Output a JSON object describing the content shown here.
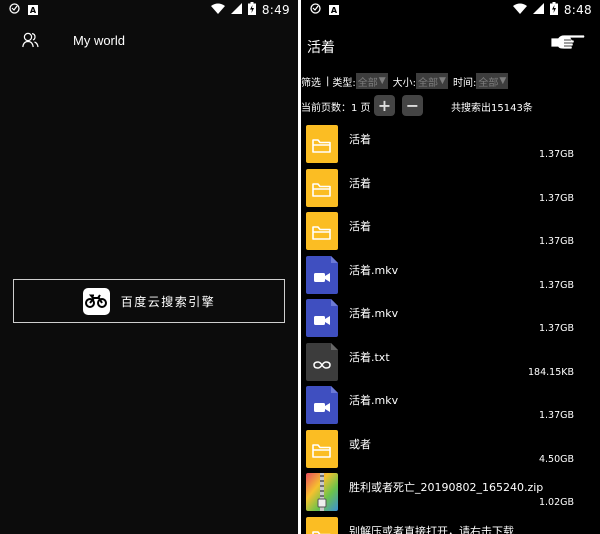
{
  "left": {
    "status": {
      "time": "8:49"
    },
    "header": {
      "title": "My world"
    },
    "search_engine": {
      "label": "百度云搜索引擎"
    }
  },
  "right": {
    "status": {
      "time": "8:48"
    },
    "toolbar": {
      "title": "活着"
    },
    "filters": {
      "screen_label": "筛选",
      "separator": "|",
      "type_label": "类型:",
      "type_value": "全部",
      "size_label": "大小:",
      "size_value": "全部",
      "time_label": "时间:",
      "time_value": "全部"
    },
    "paging": {
      "current_page_label": "当前页数：1 页",
      "plus": "+",
      "minus": "−",
      "total": "共搜索出15143条"
    },
    "files": [
      {
        "name": "活着",
        "size": "1.37GB",
        "type": "folder"
      },
      {
        "name": "活着",
        "size": "1.37GB",
        "type": "folder"
      },
      {
        "name": "活着",
        "size": "1.37GB",
        "type": "folder"
      },
      {
        "name": "活着.mkv",
        "size": "1.37GB",
        "type": "video"
      },
      {
        "name": "活着.mkv",
        "size": "1.37GB",
        "type": "video"
      },
      {
        "name": "活着.txt",
        "size": "184.15KB",
        "type": "text"
      },
      {
        "name": "活着.mkv",
        "size": "1.37GB",
        "type": "video"
      },
      {
        "name": "或者",
        "size": "4.50GB",
        "type": "folder"
      },
      {
        "name": "胜利或者死亡_20190802_165240.zip",
        "size": "1.02GB",
        "type": "zip"
      },
      {
        "name": "别解压或者直接打开，请右击下载",
        "size": "",
        "type": "folder"
      }
    ]
  },
  "colors": {
    "folder": "#fbbd23",
    "video": "#3f4fc0",
    "text": "#3c3c3c",
    "zip": "#f2b62c",
    "filter_bg": "#3d3d3d"
  }
}
